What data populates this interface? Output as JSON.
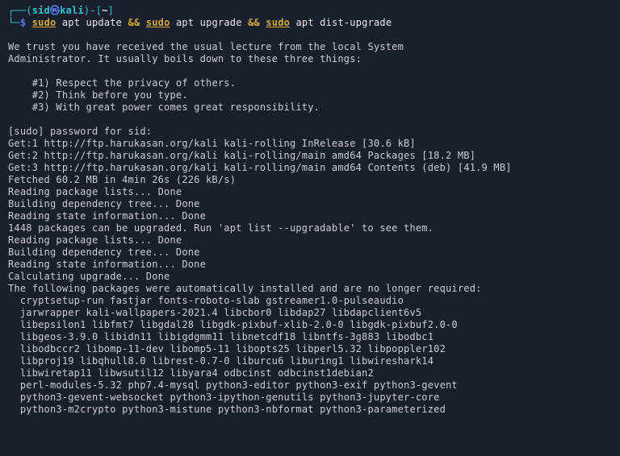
{
  "prompt": {
    "box_open": "┌──(",
    "user": "sid",
    "at": "㉿",
    "host": "kali",
    "box_close": ")-[",
    "cwd": "~",
    "box_end": "]",
    "line2_prefix": "└─",
    "dollar": "$ ",
    "cmd_sudo": "sudo",
    "cmd_apt1": " apt update ",
    "cmd_and": "&&",
    "cmd_space": " ",
    "cmd_apt2": " apt upgrade ",
    "cmd_apt3": " apt dist-upgrade"
  },
  "lines": {
    "l1": "We trust you have received the usual lecture from the local System",
    "l2": "Administrator. It usually boils down to these three things:",
    "l3": "    #1) Respect the privacy of others.",
    "l4": "    #2) Think before you type.",
    "l5": "    #3) With great power comes great responsibility.",
    "l6": "[sudo] password for sid:",
    "l7": "Get:1 http://ftp.harukasan.org/kali kali-rolling InRelease [30.6 kB]",
    "l8": "Get:2 http://ftp.harukasan.org/kali kali-rolling/main amd64 Packages [18.2 MB]",
    "l9": "Get:3 http://ftp.harukasan.org/kali kali-rolling/main amd64 Contents (deb) [41.9 MB]",
    "l10": "Fetched 60.2 MB in 4min 26s (226 kB/s)",
    "l11a": "Reading package lists",
    "dots": "...",
    "done": " Done",
    "l12a": "Building dependency tree",
    "l13a": "Reading state information",
    "l14": "1448 packages can be upgraded. Run 'apt list --upgradable' to see them.",
    "l18a": "Calculating upgrade",
    "l19": "The following packages were automatically installed and are no longer required:",
    "p1": "  cryptsetup-run fastjar fonts-roboto-slab gstreamer1.0-pulseaudio",
    "p2": "  jarwrapper kali-wallpapers-2021.4 libcbor0 libdap27 libdapclient6v5",
    "p3": "  libepsilon1 libfmt7 libgdal28 libgdk-pixbuf-xlib-2.0-0 libgdk-pixbuf2.0-0",
    "p4": "  libgeos-3.9.0 libidn11 libigdgmm11 libnetcdf18 libntfs-3g883 libodbc1",
    "p5": "  libodbccr2 libomp-11-dev libomp5-11 libopts25 libperl5.32 libpoppler102",
    "p6": "  libproj19 libqhull8.0 librest-0.7-0 liburcu6 liburing1 libwireshark14",
    "p7": "  libwiretap11 libwsutil12 libyara4 odbcinst odbcinst1debian2",
    "p8": "  perl-modules-5.32 php7.4-mysql python3-editor python3-exif python3-gevent",
    "p9": "  python3-gevent-websocket python3-ipython-genutils python3-jupyter-core",
    "p10": "  python3-m2crypto python3-mistune python3-nbformat python3-parameterized"
  }
}
